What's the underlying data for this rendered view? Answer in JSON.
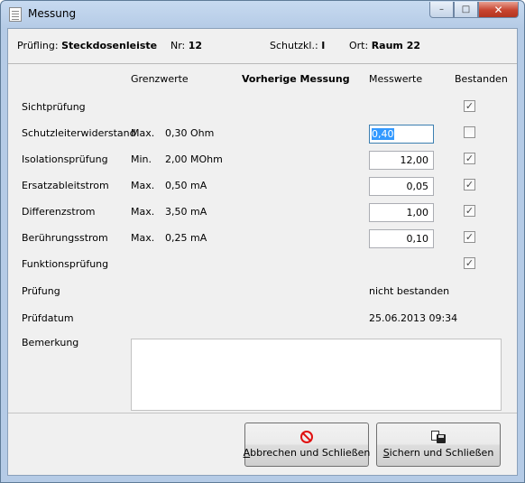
{
  "window": {
    "title": "Messung",
    "minimize": "–",
    "maximize": "□",
    "close": "✕"
  },
  "header": {
    "pruefling_label": "Prüfling:",
    "pruefling_value": "Steckdosenleiste",
    "nr_label": "Nr:",
    "nr_value": "12",
    "schutzkl_label": "Schutzkl.:",
    "schutzkl_value": "I",
    "ort_label": "Ort:",
    "ort_value": "Raum 22"
  },
  "columns": {
    "grenzwerte": "Grenzwerte",
    "vorherige": "Vorherige Messung",
    "messwerte": "Messwerte",
    "bestanden": "Bestanden"
  },
  "rows": [
    {
      "label": "Sichtprüfung",
      "limit_prefix": "",
      "limit_value": "",
      "measure": "",
      "passed": true
    },
    {
      "label": "Schutzleiterwiderstand",
      "limit_prefix": "Max.",
      "limit_value": "0,30 Ohm",
      "measure": "0,40",
      "passed": false
    },
    {
      "label": "Isolationsprüfung",
      "limit_prefix": "Min.",
      "limit_value": "2,00 MOhm",
      "measure": "12,00",
      "passed": true
    },
    {
      "label": "Ersatzableitstrom",
      "limit_prefix": "Max.",
      "limit_value": "0,50 mA",
      "measure": "0,05",
      "passed": true
    },
    {
      "label": "Differenzstrom",
      "limit_prefix": "Max.",
      "limit_value": "3,50 mA",
      "measure": "1,00",
      "passed": true
    },
    {
      "label": "Berührungsstrom",
      "limit_prefix": "Max.",
      "limit_value": "0,25 mA",
      "measure": "0,10",
      "passed": true
    },
    {
      "label": "Funktionsprüfung",
      "limit_prefix": "",
      "limit_value": "",
      "measure": "",
      "passed": true
    }
  ],
  "pruefung": {
    "label": "Prüfung",
    "value": "nicht bestanden"
  },
  "pruefdatum": {
    "label": "Prüfdatum",
    "value": "25.06.2013 09:34"
  },
  "bemerkung": {
    "label": "Bemerkung",
    "value": ""
  },
  "buttons": {
    "cancel_underline": "A",
    "cancel_rest": "bbrechen und Schließen",
    "save_underline": "S",
    "save_rest": "ichern und Schließen"
  },
  "checkmark": "✓"
}
